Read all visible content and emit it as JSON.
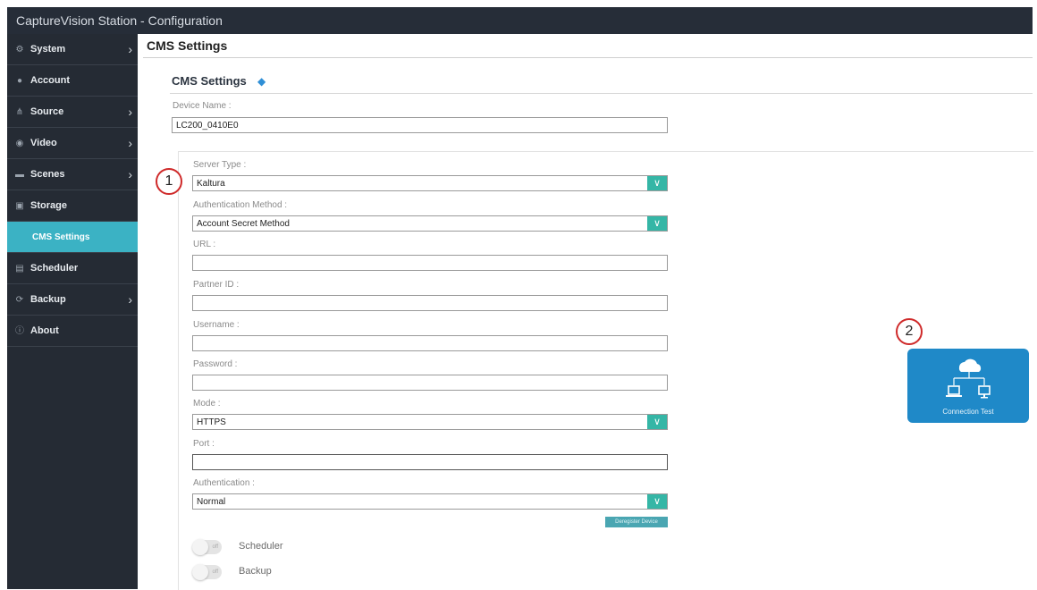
{
  "window": {
    "title": "CaptureVision Station - Configuration"
  },
  "sidebar": {
    "items": [
      {
        "label": "System",
        "icon": "gear-icon",
        "glyph": "⚙",
        "has_submenu": true
      },
      {
        "label": "Account",
        "icon": "user-icon",
        "glyph": "●",
        "has_submenu": false
      },
      {
        "label": "Source",
        "icon": "source-icon",
        "glyph": "⋔",
        "has_submenu": true
      },
      {
        "label": "Video",
        "icon": "video-icon",
        "glyph": "◉",
        "has_submenu": true
      },
      {
        "label": "Scenes",
        "icon": "scenes-icon",
        "glyph": "▬",
        "has_submenu": true
      },
      {
        "label": "Storage",
        "icon": "storage-icon",
        "glyph": "▣",
        "has_submenu": false
      },
      {
        "label": "CMS Settings",
        "icon": "",
        "glyph": "",
        "has_submenu": false,
        "active": true
      },
      {
        "label": "Scheduler",
        "icon": "calendar-icon",
        "glyph": "▤",
        "has_submenu": false
      },
      {
        "label": "Backup",
        "icon": "backup-icon",
        "glyph": "⟳",
        "has_submenu": true
      },
      {
        "label": "About",
        "icon": "info-icon",
        "glyph": "ⓘ",
        "has_submenu": false
      }
    ]
  },
  "main": {
    "title": "CMS Settings",
    "section_title": "CMS Settings"
  },
  "form": {
    "device_name_label": "Device Name :",
    "device_name_value": "LC200_0410E0",
    "server_type_label": "Server Type :",
    "server_type_value": "Kaltura",
    "auth_method_label": "Authentication Method :",
    "auth_method_value": "Account Secret Method",
    "url_label": "URL :",
    "partner_id_label": "Partner ID :",
    "username_label": "Username :",
    "password_label": "Password :",
    "mode_label": "Mode :",
    "mode_value": "HTTPS",
    "port_label": "Port :",
    "authentication_label": "Authentication :",
    "authentication_value": "Normal",
    "register_button": "Deregister Device",
    "toggle_off_text": "off",
    "scheduler_label": "Scheduler",
    "backup_label": "Backup"
  },
  "callouts": {
    "one": "1",
    "two": "2"
  },
  "connection_test": {
    "label": "Connection Test"
  },
  "colors": {
    "sidebar_bg": "#252b34",
    "active_item": "#3bb2c4",
    "select_arrow": "#35b6a6",
    "connection_test_bg": "#1f89c8",
    "callout_border": "#cf2a2a"
  }
}
